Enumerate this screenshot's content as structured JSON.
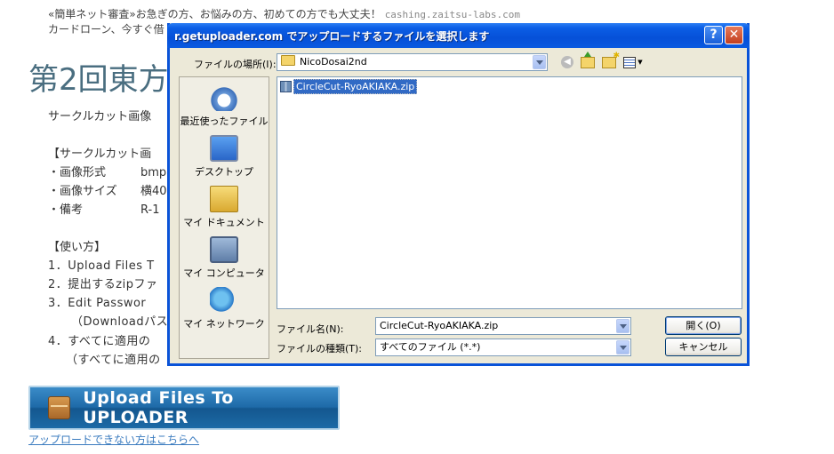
{
  "page": {
    "ad_line1": "«簡単ネット審査»お急ぎの方、お悩みの方、初めての方でも大丈夫！",
    "ad_url": "cashing.zaitsu-labs.com",
    "ad_line2": "カードローン、今すぐ借",
    "title": "第2回東方",
    "description": "サークルカット画像",
    "spec_heading": "【サークルカット画",
    "specs": [
      {
        "key": "・画像形式",
        "val": "bmp"
      },
      {
        "key": "・画像サイズ",
        "val": "横40"
      },
      {
        "key": "・備考",
        "val": "R-1"
      }
    ],
    "usage_heading": "【使い方】",
    "steps": [
      "1．Upload Files T",
      "2．提出するzipファ",
      "3．Edit Passwor",
      "（Downloadパス",
      "4．すべてに適用の",
      "（すべてに適用の"
    ],
    "upload_button": "Upload Files To UPLOADER",
    "help_link": "アップロードできない方はこちらへ"
  },
  "dialog": {
    "title": "r.getuploader.com でアップロードするファイルを選択します",
    "help_btn": "?",
    "close_btn": "✕",
    "look_in_label": "ファイルの場所(I):",
    "look_in_value": "NicoDosai2nd",
    "places": [
      "最近使ったファイル",
      "デスクトップ",
      "マイ ドキュメント",
      "マイ コンピュータ",
      "マイ ネットワーク"
    ],
    "files": [
      "CircleCut-RyoAKIAKA.zip"
    ],
    "filename_label": "ファイル名(N):",
    "filename_value": "CircleCut-RyoAKIAKA.zip",
    "filetype_label": "ファイルの種類(T):",
    "filetype_value": "すべてのファイル (*.*)",
    "open_btn": "開く(O)",
    "cancel_btn": "キャンセル"
  }
}
